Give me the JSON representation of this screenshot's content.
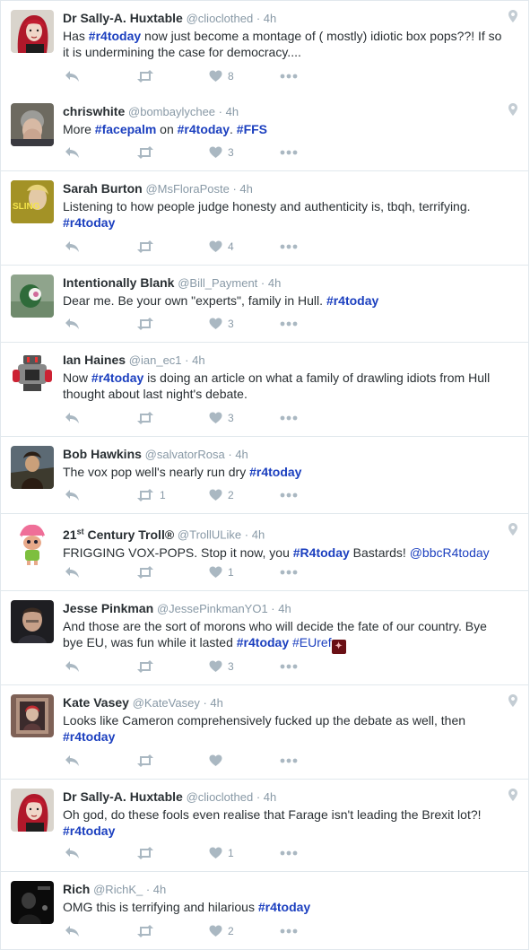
{
  "tweets": [
    {
      "name": "Dr Sally-A. Huxtable",
      "handle": "@clioclothed",
      "time": "4h",
      "text": [
        [
          "t",
          "Has "
        ],
        [
          "h",
          "#r4today"
        ],
        [
          "t",
          " now just become a montage of ( mostly) idiotic box pops??! If so it is undermining the case for democracy...."
        ]
      ],
      "likes": "8",
      "retweets": "",
      "geo": true,
      "avatar": "red-hair-woman"
    },
    {
      "name": "chriswhite",
      "handle": "@bombaylychee",
      "time": "4h",
      "text": [
        [
          "t",
          "More "
        ],
        [
          "h",
          "#facepalm"
        ],
        [
          "t",
          " on "
        ],
        [
          "h",
          "#r4today"
        ],
        [
          "t",
          ". "
        ],
        [
          "h",
          "#FFS"
        ]
      ],
      "likes": "3",
      "retweets": "",
      "geo": true,
      "avatar": "facepalm-man"
    },
    {
      "name": "Sarah Burton",
      "handle": "@MsFloraPoste",
      "time": "4h",
      "text": [
        [
          "t",
          "Listening to how people judge honesty and authenticity is, tbqh, terrifying. "
        ],
        [
          "h",
          "#r4today"
        ]
      ],
      "likes": "4",
      "retweets": "",
      "geo": false,
      "avatar": "sling-poster"
    },
    {
      "name": "Intentionally Blank",
      "handle": "@Bill_Payment",
      "time": "4h",
      "text": [
        [
          "t",
          "Dear me. Be your own \"experts\", family in Hull. "
        ],
        [
          "h",
          "#r4today"
        ]
      ],
      "likes": "3",
      "retweets": "",
      "geo": false,
      "avatar": "green-creature"
    },
    {
      "name": "Ian Haines",
      "handle": "@ian_ec1",
      "time": "4h",
      "text": [
        [
          "t",
          "Now "
        ],
        [
          "h",
          "#r4today"
        ],
        [
          "t",
          " is doing an article on what a family of drawling idiots from Hull thought about last night's debate."
        ]
      ],
      "likes": "3",
      "retweets": "",
      "geo": false,
      "avatar": "robot"
    },
    {
      "name": "Bob Hawkins",
      "handle": "@salvatorRosa",
      "time": "4h",
      "text": [
        [
          "t",
          "The vox pop well's nearly run dry "
        ],
        [
          "h",
          "#r4today"
        ]
      ],
      "likes": "2",
      "retweets": "1",
      "geo": false,
      "avatar": "painting-portrait"
    },
    {
      "name": "21",
      "name_sup": "st",
      "name_rest": " Century Troll®",
      "handle": "@TrollULike",
      "time": "4h",
      "text": [
        [
          "t",
          "FRIGGING VOX-POPS. Stop it now, you "
        ],
        [
          "h",
          "#R4today"
        ],
        [
          "t",
          " Bastards!  "
        ],
        [
          "m",
          "@bbcR4today"
        ]
      ],
      "likes": "1",
      "retweets": "",
      "geo": true,
      "avatar": "troll-doll"
    },
    {
      "name": "Jesse Pinkman",
      "handle": "@JessePinkmanYO1",
      "time": "4h",
      "text": [
        [
          "t",
          "And those are the sort of morons who will decide the fate of our country. Bye bye EU, was fun while it lasted "
        ],
        [
          "h",
          "#r4today"
        ],
        [
          "t",
          " "
        ],
        [
          "m",
          "#EUref"
        ],
        [
          "e",
          "emoji"
        ]
      ],
      "likes": "3",
      "retweets": "",
      "geo": false,
      "avatar": "man-dark"
    },
    {
      "name": "Kate Vasey",
      "handle": "@KateVasey",
      "time": "4h",
      "text": [
        [
          "t",
          "Looks like Cameron comprehensively fucked up the debate as well, then "
        ],
        [
          "h",
          "#r4today"
        ]
      ],
      "likes": "",
      "retweets": "",
      "geo": true,
      "avatar": "framed-portrait"
    },
    {
      "name": "Dr Sally-A. Huxtable",
      "handle": "@clioclothed",
      "time": "4h",
      "text": [
        [
          "t",
          "Oh god, do these fools even realise that Farage isn't leading the Brexit lot?! "
        ],
        [
          "h",
          "#r4today"
        ]
      ],
      "likes": "1",
      "retweets": "",
      "geo": true,
      "avatar": "red-hair-woman"
    },
    {
      "name": "Rich",
      "handle": "@RichK_",
      "time": "4h",
      "text": [
        [
          "t",
          "OMG this is terrifying and hilarious "
        ],
        [
          "h",
          "#r4today"
        ]
      ],
      "likes": "2",
      "retweets": "",
      "geo": false,
      "avatar": "dark-photo"
    }
  ],
  "icons": {
    "reply": "reply-icon",
    "retweet": "retweet-icon",
    "like": "heart-icon",
    "more": "more-icon",
    "geo": "location-pin-icon"
  },
  "colors": {
    "hashtag": "#1b3fbf",
    "muted": "#8899a6",
    "icon": "#aab8c2",
    "border": "#e1e8ed"
  }
}
